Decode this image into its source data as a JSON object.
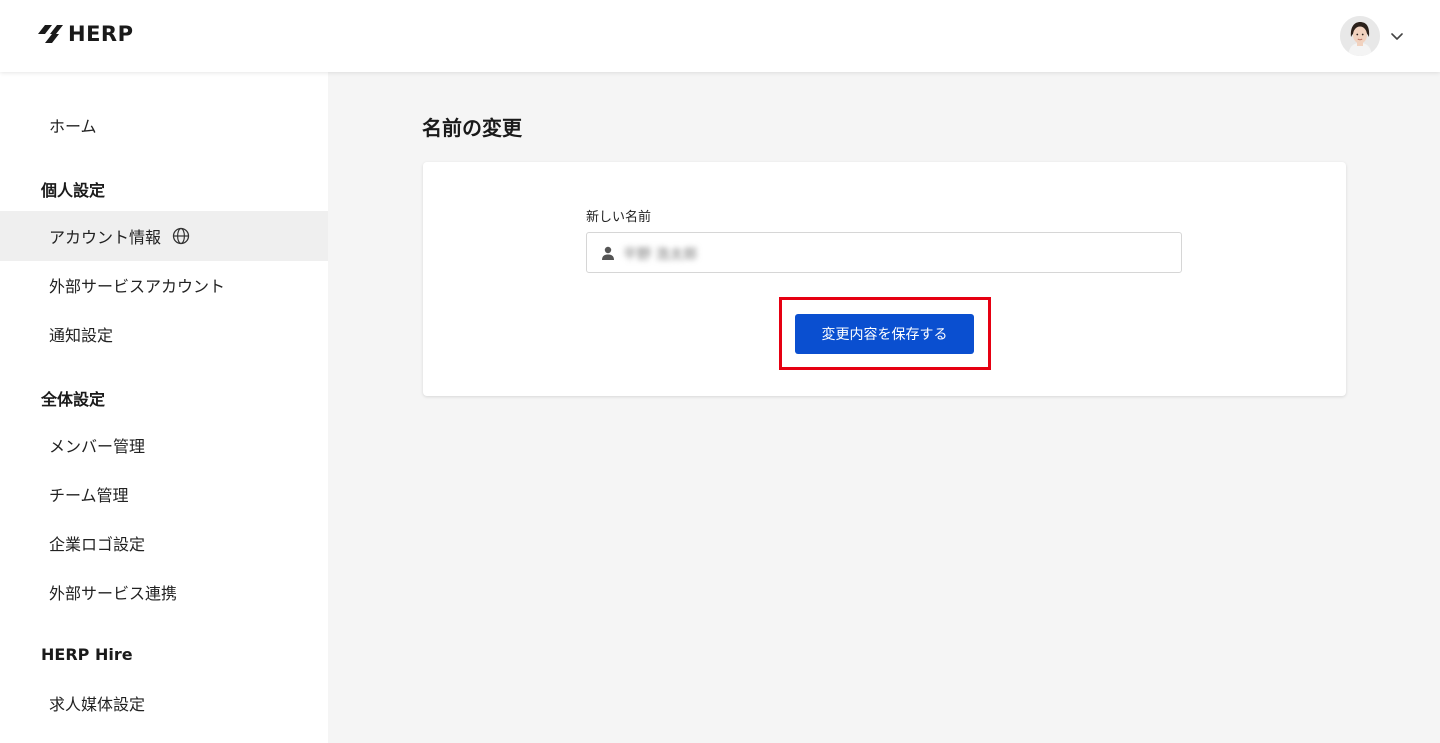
{
  "header": {
    "brand": "HERP",
    "logo_icon": "herp-logo-mark",
    "avatar_icon": "user-avatar",
    "menu_icon": "chevron-down-icon"
  },
  "sidebar": {
    "home": "ホーム",
    "personal_section": "個人設定",
    "personal_items": [
      {
        "label": "アカウント情報",
        "active": true,
        "icon": "globe-icon"
      },
      {
        "label": "外部サービスアカウント"
      },
      {
        "label": "通知設定"
      }
    ],
    "global_section": "全体設定",
    "global_items": [
      {
        "label": "メンバー管理"
      },
      {
        "label": "チーム管理"
      },
      {
        "label": "企業ロゴ設定"
      },
      {
        "label": "外部サービス連携"
      }
    ],
    "hire_section": "HERP Hire",
    "hire_items": [
      {
        "label": "求人媒体設定"
      }
    ]
  },
  "main": {
    "title": "名前の変更",
    "form": {
      "label": "新しい名前",
      "value": "平野 浩太郎",
      "input_icon": "person-icon",
      "save_label": "変更内容を保存する"
    }
  },
  "colors": {
    "primary": "#0a4fd0",
    "highlight": "#e60012",
    "active_bg": "#efefef",
    "page_bg": "#f5f5f5"
  }
}
